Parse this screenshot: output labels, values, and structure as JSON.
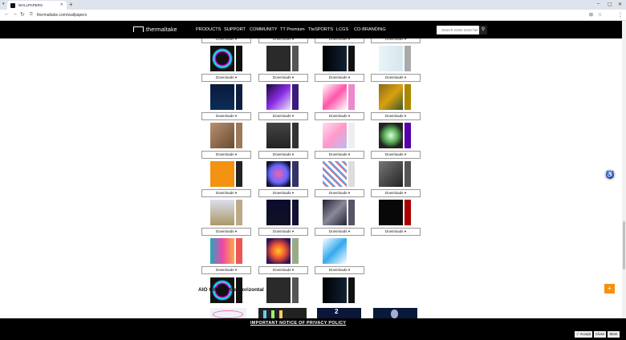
{
  "browser": {
    "tab_title": "WALLPAPERS",
    "url": "thermaltake.com/wallpapers",
    "icons": [
      "tabs-menu-icon",
      "close-icon",
      "new-tab-icon",
      "minimize-icon",
      "maximize-icon",
      "window-close-icon",
      "back-icon",
      "forward-icon",
      "reload-icon",
      "lock-icon",
      "translate-icon",
      "star-icon",
      "menu-icon"
    ]
  },
  "site": {
    "logo_text": "thermaltake",
    "menu": [
      "PRODUCTS",
      "SUPPORT",
      "COMMUNITY",
      "TT Premium",
      "TteSPORTS",
      "LCGS",
      "CO-BRANDING"
    ],
    "search_placeholder": "Search entire store her",
    "download_label": "Downloads ▾",
    "section_title": "AIO GIFs/ JPGs Horizontal",
    "accent_color": "#f39211"
  },
  "notice": {
    "text": "IMPORTANT NOTICE OF PRIVACY POLICY",
    "accept": "✓ Accept",
    "close": "Close",
    "more": "More"
  }
}
